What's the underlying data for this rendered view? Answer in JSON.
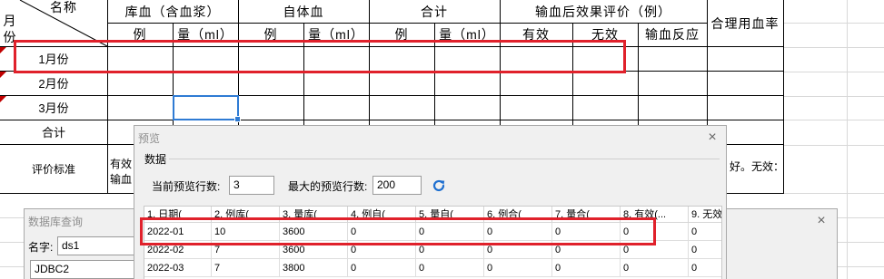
{
  "table": {
    "corner_top": "名称",
    "corner_bottom": "月份",
    "groups": [
      "库血（含血浆）",
      "自体血",
      "合计",
      "输血后效果评价（例）"
    ],
    "rate_header": "合理用血率",
    "sub_headers": [
      "例",
      "量（ml）",
      "例",
      "量（ml）",
      "例",
      "量（ml）",
      "有效",
      "无效",
      "输血反应"
    ],
    "rows": [
      "1月份",
      "2月份",
      "3月份",
      "合计"
    ],
    "criteria_label": "评价标准",
    "criteria_text_line1": "有效",
    "criteria_text_line2": "输血",
    "criteria_right_text": "好。无效："
  },
  "preview_dialog": {
    "title": "预览",
    "close_icon": "×",
    "group_title": "数据",
    "current_rows_label": "当前预览行数:",
    "current_rows_value": "3",
    "max_rows_label": "最大的预览行数:",
    "max_rows_value": "200",
    "refresh_icon": "refresh-icon",
    "columns": [
      "1. 日期(",
      "2. 例库(",
      "3. 量库(",
      "4. 例自(",
      "5. 量自(",
      "6. 例合(",
      "7. 量合(",
      "8. 有效(...",
      "9. 无效"
    ],
    "rows": [
      [
        "2022-01",
        "10",
        "3600",
        "0",
        "0",
        "0",
        "0",
        "0",
        "0"
      ],
      [
        "2022-02",
        "7",
        "3600",
        "0",
        "0",
        "0",
        "0",
        "0",
        "0"
      ],
      [
        "2022-03",
        "7",
        "3800",
        "0",
        "0",
        "0",
        "0",
        "0",
        "0"
      ]
    ]
  },
  "db_dialog": {
    "title": "数据库查询",
    "close_icon": "×",
    "name_label": "名字:",
    "name_value": "ds1",
    "connection_value": "JDBC2"
  },
  "colors": {
    "highlight_red": "#e0212b",
    "selection_blue": "#2f7bd4",
    "refresh_blue": "#1e6fd0"
  }
}
